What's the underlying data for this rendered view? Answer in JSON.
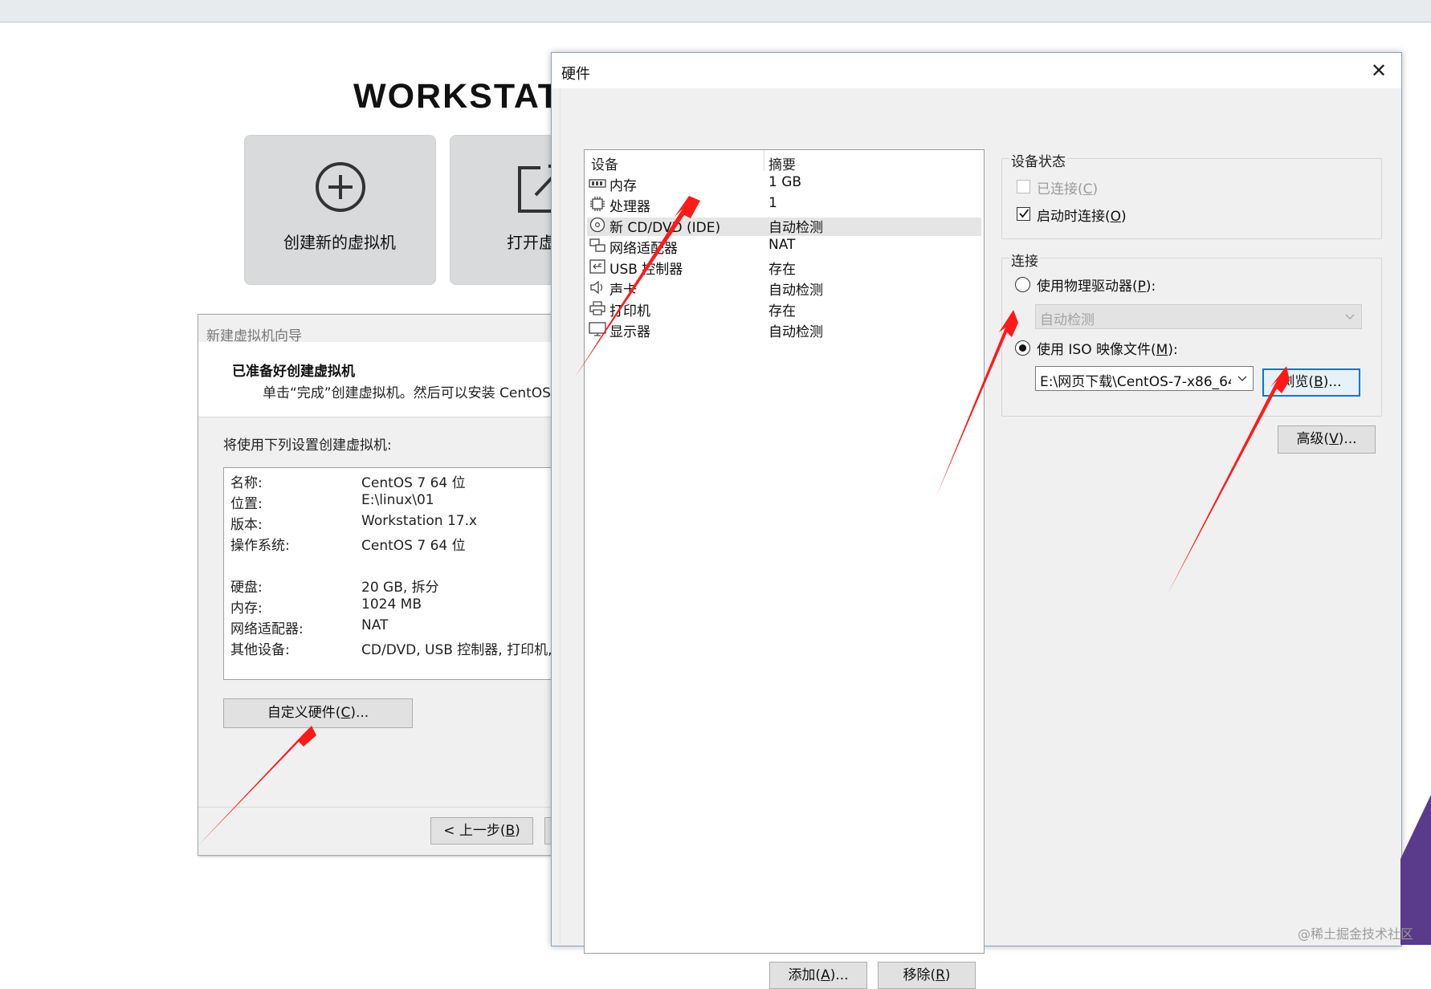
{
  "home": {
    "brand": "WORKSTAT",
    "tile_create": "创建新的虚拟机",
    "tile_open": "打开虚"
  },
  "wizard": {
    "title": "新建虚拟机向导",
    "heading": "已准备好创建虚拟机",
    "subheading": "单击“完成”创建虚拟机。然后可以安装 CentOS",
    "lead": "将使用下列设置创建虚拟机:",
    "summary": [
      {
        "key": "名称:",
        "value": "CentOS 7 64 位"
      },
      {
        "key": "位置:",
        "value": "E:\\linux\\01"
      },
      {
        "key": "版本:",
        "value": "Workstation 17.x"
      },
      {
        "key": "操作系统:",
        "value": "CentOS 7 64 位"
      },
      {
        "key": "硬盘:",
        "value": "20 GB, 拆分"
      },
      {
        "key": "内存:",
        "value": "1024 MB"
      },
      {
        "key": "网络适配器:",
        "value": "NAT"
      },
      {
        "key": "其他设备:",
        "value": "CD/DVD, USB 控制器, 打印机,"
      }
    ],
    "customize_button": {
      "pre": "自定义硬件(",
      "key": "C",
      "post": ")..."
    },
    "back_button": {
      "pre": "< 上一步(",
      "key": "B",
      "post": ")"
    }
  },
  "hardware": {
    "title": "硬件",
    "close_symbol": "✕",
    "columns": {
      "device": "设备",
      "summary": "摘要"
    },
    "devices": [
      {
        "name": "内存",
        "summary": "1 GB",
        "icon": "memory-icon"
      },
      {
        "name": "处理器",
        "summary": "1",
        "icon": "processor-icon"
      },
      {
        "name": "新 CD/DVD (IDE)",
        "summary": "自动检测",
        "icon": "cd-dvd-icon",
        "selected": true
      },
      {
        "name": "网络适配器",
        "summary": "NAT",
        "icon": "network-adapter-icon"
      },
      {
        "name": "USB 控制器",
        "summary": "存在",
        "icon": "usb-icon"
      },
      {
        "name": "声卡",
        "summary": "自动检测",
        "icon": "sound-card-icon"
      },
      {
        "name": "打印机",
        "summary": "存在",
        "icon": "printer-icon"
      },
      {
        "name": "显示器",
        "summary": "自动检测",
        "icon": "display-icon"
      }
    ],
    "device_status": {
      "label": "设备状态",
      "connected": {
        "pre": "已连接(",
        "key": "C",
        "post": ")",
        "checked": false,
        "enabled": false
      },
      "connect_at_power_on": {
        "pre": "启动时连接(",
        "key": "O",
        "post": ")",
        "checked": true
      }
    },
    "connection": {
      "label": "连接",
      "physical": {
        "pre": "使用物理驱动器(",
        "key": "P",
        "post": "):",
        "selected": false
      },
      "physical_select": "自动检测",
      "iso": {
        "pre": "使用 ISO 映像文件(",
        "key": "M",
        "post": "):",
        "selected": true
      },
      "iso_path": "E:\\网页下载\\CentOS-7-x86_64",
      "browse_button": {
        "pre": "浏览(",
        "key": "B",
        "post": ")..."
      }
    },
    "advanced_button": {
      "pre": "高级(",
      "key": "V",
      "post": ")..."
    },
    "add_button": {
      "pre": "添加(",
      "key": "A",
      "post": ")..."
    },
    "remove_button": {
      "pre": "移除(",
      "key": "R",
      "post": ")"
    }
  },
  "watermark": "@稀土掘金技术社区",
  "colors": {
    "annotation_arrow": "#ff1a1a",
    "focus_border": "#0078d7"
  }
}
